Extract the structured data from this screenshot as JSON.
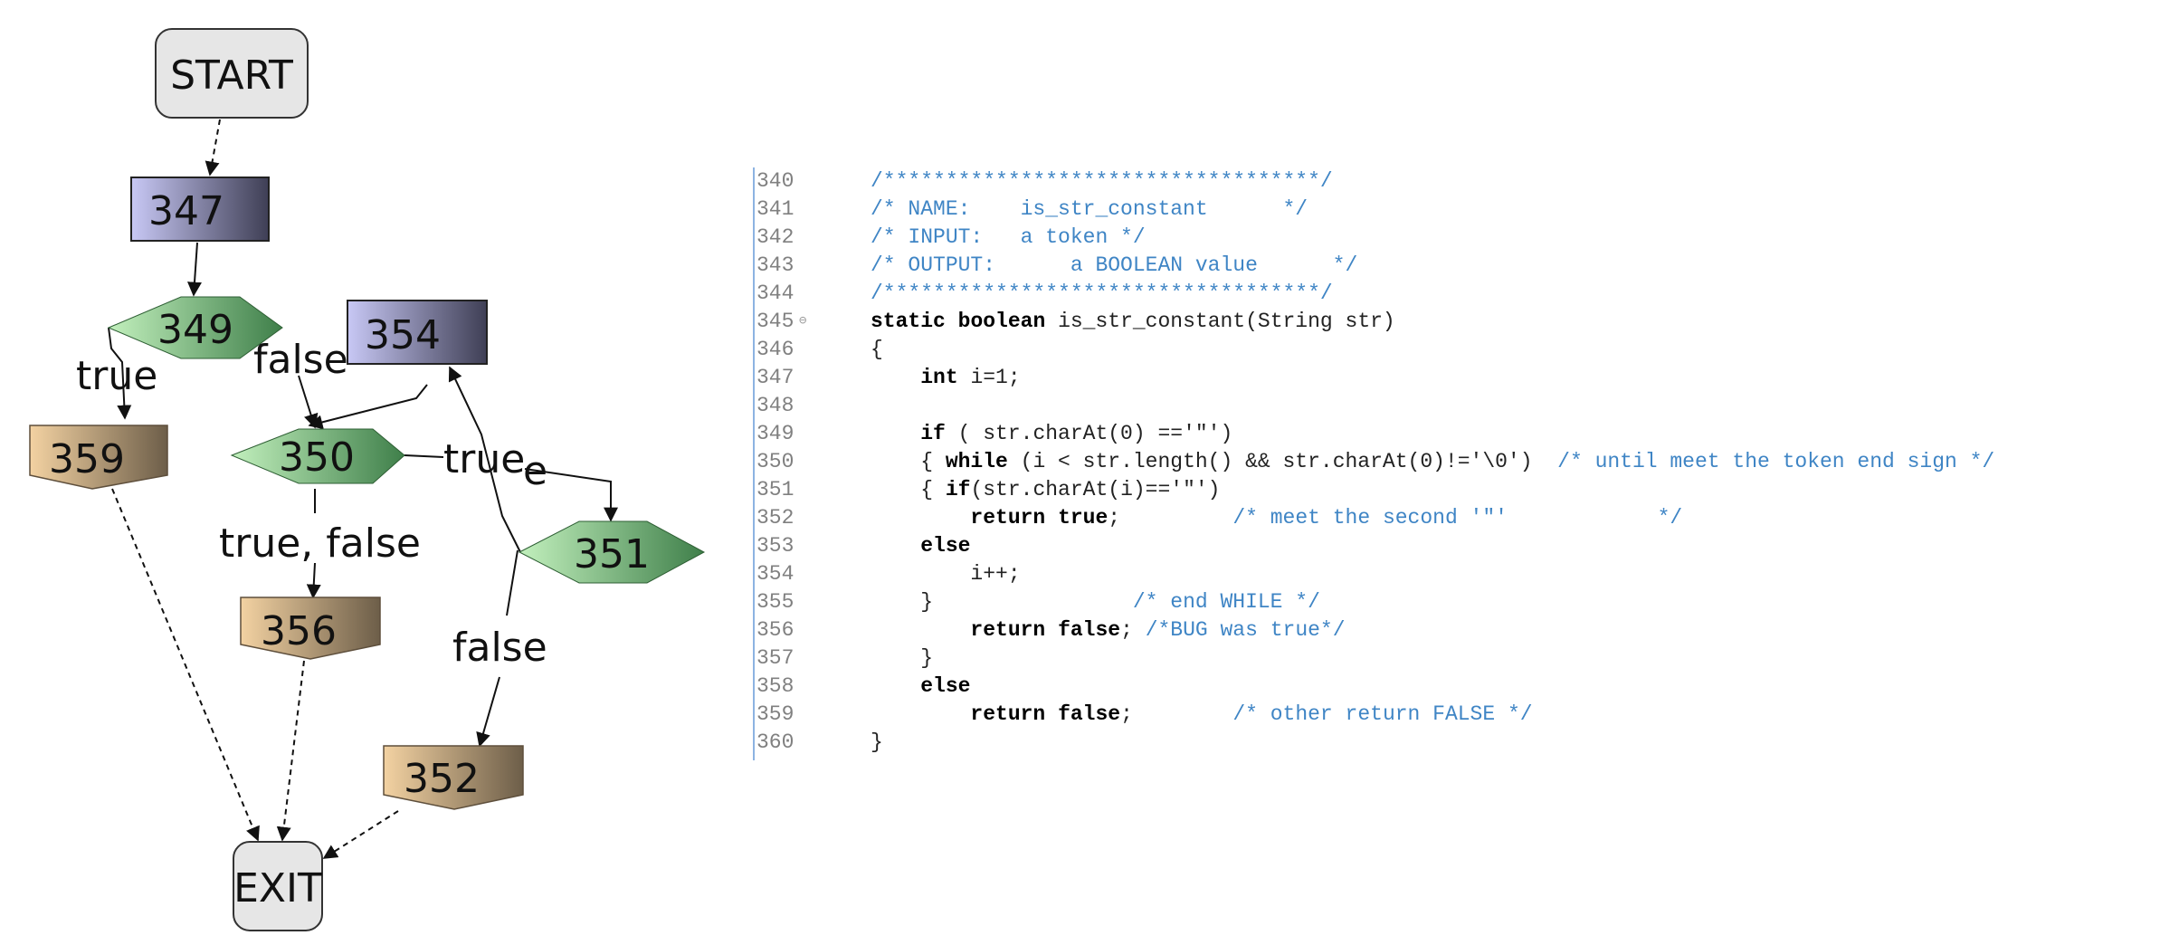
{
  "diagram": {
    "nodes": {
      "start": "START",
      "n347": "347",
      "n349": "349",
      "n354": "354",
      "n359": "359",
      "n350": "350",
      "n351": "351",
      "n356": "356",
      "n352": "352",
      "exit": "EXIT"
    },
    "edge_labels": {
      "l349_true": "true",
      "l349_false": "false",
      "l350_true": "true",
      "l350_truefalse": "true, false",
      "l351_false": "false",
      "l_e": "e"
    },
    "colors": {
      "terminal_fill": "#e6e6e6",
      "statement_gradient_start": "#c8c8f5",
      "statement_gradient_end": "#3f3f55",
      "decision_gradient_start": "#c2f0bd",
      "decision_gradient_end": "#3f7f4a",
      "return_gradient_start": "#f3d2a2",
      "return_gradient_end": "#6d5e49"
    }
  },
  "code": {
    "lines": [
      {
        "num": "340",
        "indent": "",
        "segments": [
          {
            "t": "/***********************************/",
            "c": "cm"
          }
        ]
      },
      {
        "num": "341",
        "indent": "",
        "segments": [
          {
            "t": "/* NAME:    is_str_constant      */",
            "c": "cm"
          }
        ]
      },
      {
        "num": "342",
        "indent": "",
        "segments": [
          {
            "t": "/* INPUT:   a token */",
            "c": "cm"
          }
        ]
      },
      {
        "num": "343",
        "indent": "",
        "segments": [
          {
            "t": "/* OUTPUT:      a BOOLEAN value      */",
            "c": "cm"
          }
        ]
      },
      {
        "num": "344",
        "indent": "",
        "segments": [
          {
            "t": "/***********************************/",
            "c": "cm"
          }
        ]
      },
      {
        "num": "345",
        "fold": true,
        "indent": "",
        "segments": [
          {
            "t": "static",
            "c": "kw"
          },
          {
            "t": " "
          },
          {
            "t": "boolean",
            "c": "kw"
          },
          {
            "t": " is_str_constant(String str)"
          }
        ]
      },
      {
        "num": "346",
        "indent": "",
        "segments": [
          {
            "t": "{"
          }
        ]
      },
      {
        "num": "347",
        "indent": "    ",
        "segments": [
          {
            "t": "int",
            "c": "kw"
          },
          {
            "t": " i=1;"
          }
        ]
      },
      {
        "num": "348",
        "indent": "",
        "segments": []
      },
      {
        "num": "349",
        "indent": "    ",
        "segments": [
          {
            "t": "if",
            "c": "kw"
          },
          {
            "t": " ( str.charAt(0) =='\"')"
          }
        ]
      },
      {
        "num": "350",
        "indent": "    ",
        "segments": [
          {
            "t": "{ "
          },
          {
            "t": "while",
            "c": "kw"
          },
          {
            "t": " (i < str.length() && str.charAt(0)!='\\0')  "
          },
          {
            "t": "/* until meet the token end sign */",
            "c": "cm"
          }
        ]
      },
      {
        "num": "351",
        "indent": "    ",
        "segments": [
          {
            "t": "{ "
          },
          {
            "t": "if",
            "c": "kw"
          },
          {
            "t": "(str.charAt(i)=='\"')"
          }
        ]
      },
      {
        "num": "352",
        "indent": "        ",
        "segments": [
          {
            "t": "return",
            "c": "kw"
          },
          {
            "t": " "
          },
          {
            "t": "true",
            "c": "kw"
          },
          {
            "t": ";         "
          },
          {
            "t": "/* meet the second '\"'            */",
            "c": "cm"
          }
        ]
      },
      {
        "num": "353",
        "indent": "    ",
        "segments": [
          {
            "t": "else",
            "c": "kw"
          }
        ]
      },
      {
        "num": "354",
        "indent": "        ",
        "segments": [
          {
            "t": "i++;"
          }
        ]
      },
      {
        "num": "355",
        "indent": "    ",
        "segments": [
          {
            "t": "}                "
          },
          {
            "t": "/* end WHILE */",
            "c": "cm"
          }
        ]
      },
      {
        "num": "356",
        "indent": "        ",
        "segments": [
          {
            "t": "return",
            "c": "kw"
          },
          {
            "t": " "
          },
          {
            "t": "false",
            "c": "kw"
          },
          {
            "t": "; "
          },
          {
            "t": "/*BUG was true*/",
            "c": "cm"
          }
        ]
      },
      {
        "num": "357",
        "indent": "    ",
        "segments": [
          {
            "t": "}"
          }
        ]
      },
      {
        "num": "358",
        "indent": "    ",
        "segments": [
          {
            "t": "else",
            "c": "kw"
          }
        ]
      },
      {
        "num": "359",
        "indent": "        ",
        "segments": [
          {
            "t": "return",
            "c": "kw"
          },
          {
            "t": " "
          },
          {
            "t": "false",
            "c": "kw"
          },
          {
            "t": ";        "
          },
          {
            "t": "/* other return FALSE */",
            "c": "cm"
          }
        ]
      },
      {
        "num": "360",
        "indent": "",
        "segments": [
          {
            "t": "}"
          }
        ]
      }
    ]
  }
}
